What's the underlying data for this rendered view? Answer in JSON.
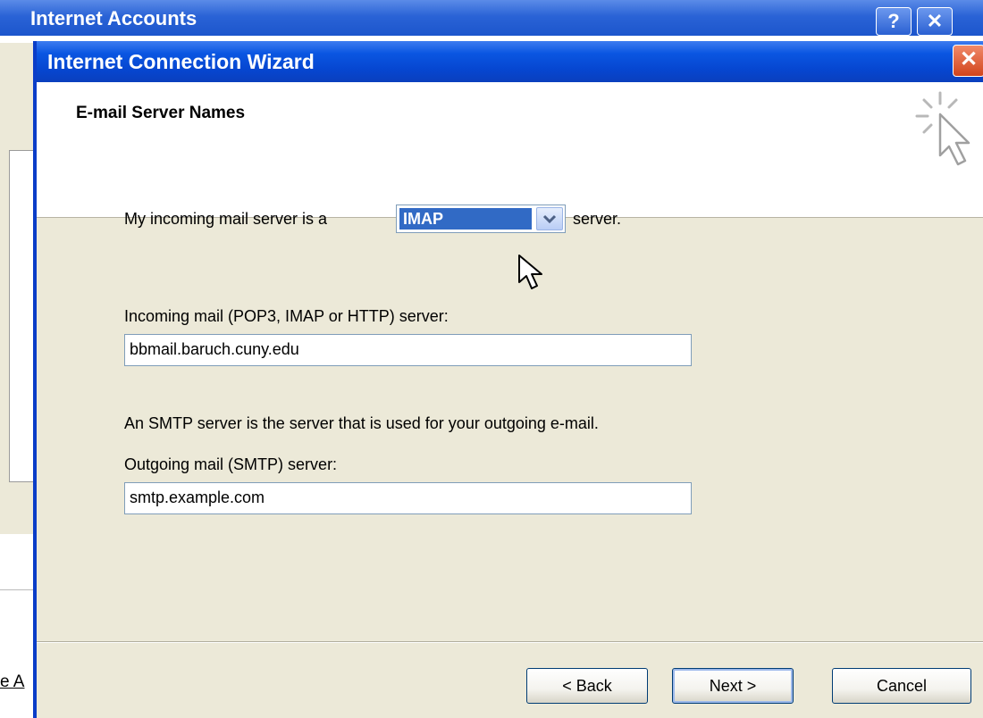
{
  "background_window": {
    "title": "Internet Accounts",
    "help_button": "?",
    "close_button": "✕",
    "partial_link": "e A"
  },
  "wizard": {
    "title": "Internet Connection Wizard",
    "close_button": "✕",
    "heading": "E-mail Server Names",
    "incoming_type": {
      "prefix": "My incoming mail server is a",
      "selected": "IMAP",
      "suffix": "server."
    },
    "incoming_server": {
      "label": "Incoming mail (POP3, IMAP or HTTP) server:",
      "value": "bbmail.baruch.cuny.edu"
    },
    "smtp_note": "An SMTP server is the server that is used for your outgoing e-mail.",
    "outgoing_server": {
      "label": "Outgoing mail (SMTP) server:",
      "value": "smtp.example.com"
    },
    "buttons": {
      "back": "< Back",
      "next": "Next >",
      "cancel": "Cancel"
    }
  },
  "colors": {
    "titlebar": "#0a56e2",
    "dialog_bg": "#ece9d8",
    "selection": "#316ac5",
    "close_button": "#d2441c"
  }
}
